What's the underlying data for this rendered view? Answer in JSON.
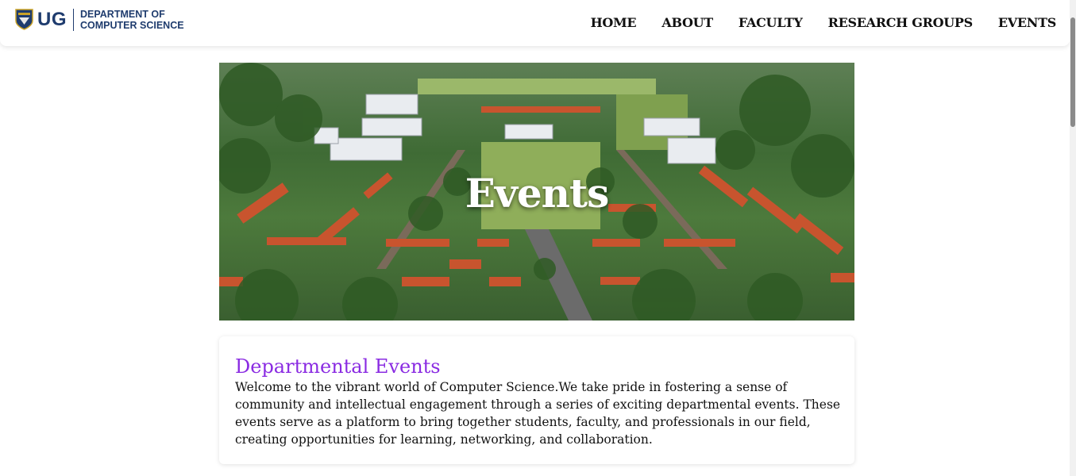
{
  "header": {
    "logo_ug": "UG",
    "dept_line1": "DEPARTMENT OF",
    "dept_line2": "COMPUTER SCIENCE"
  },
  "nav": {
    "items": [
      "HOME",
      "ABOUT",
      "FACULTY",
      "RESEARCH GROUPS",
      "EVENTS"
    ]
  },
  "hero": {
    "title": "Events"
  },
  "card": {
    "title": "Departmental Events",
    "body": "Welcome to the vibrant world of Computer Science.We take pride in fostering a sense of community and intellectual engagement through a series of exciting departmental events. These events serve as a platform to bring together students, faculty, and professionals in our field, creating opportunities for learning, networking, and collaboration."
  },
  "colors": {
    "brand_blue": "#1f3c6e",
    "heading_purple": "#8a2be2"
  }
}
